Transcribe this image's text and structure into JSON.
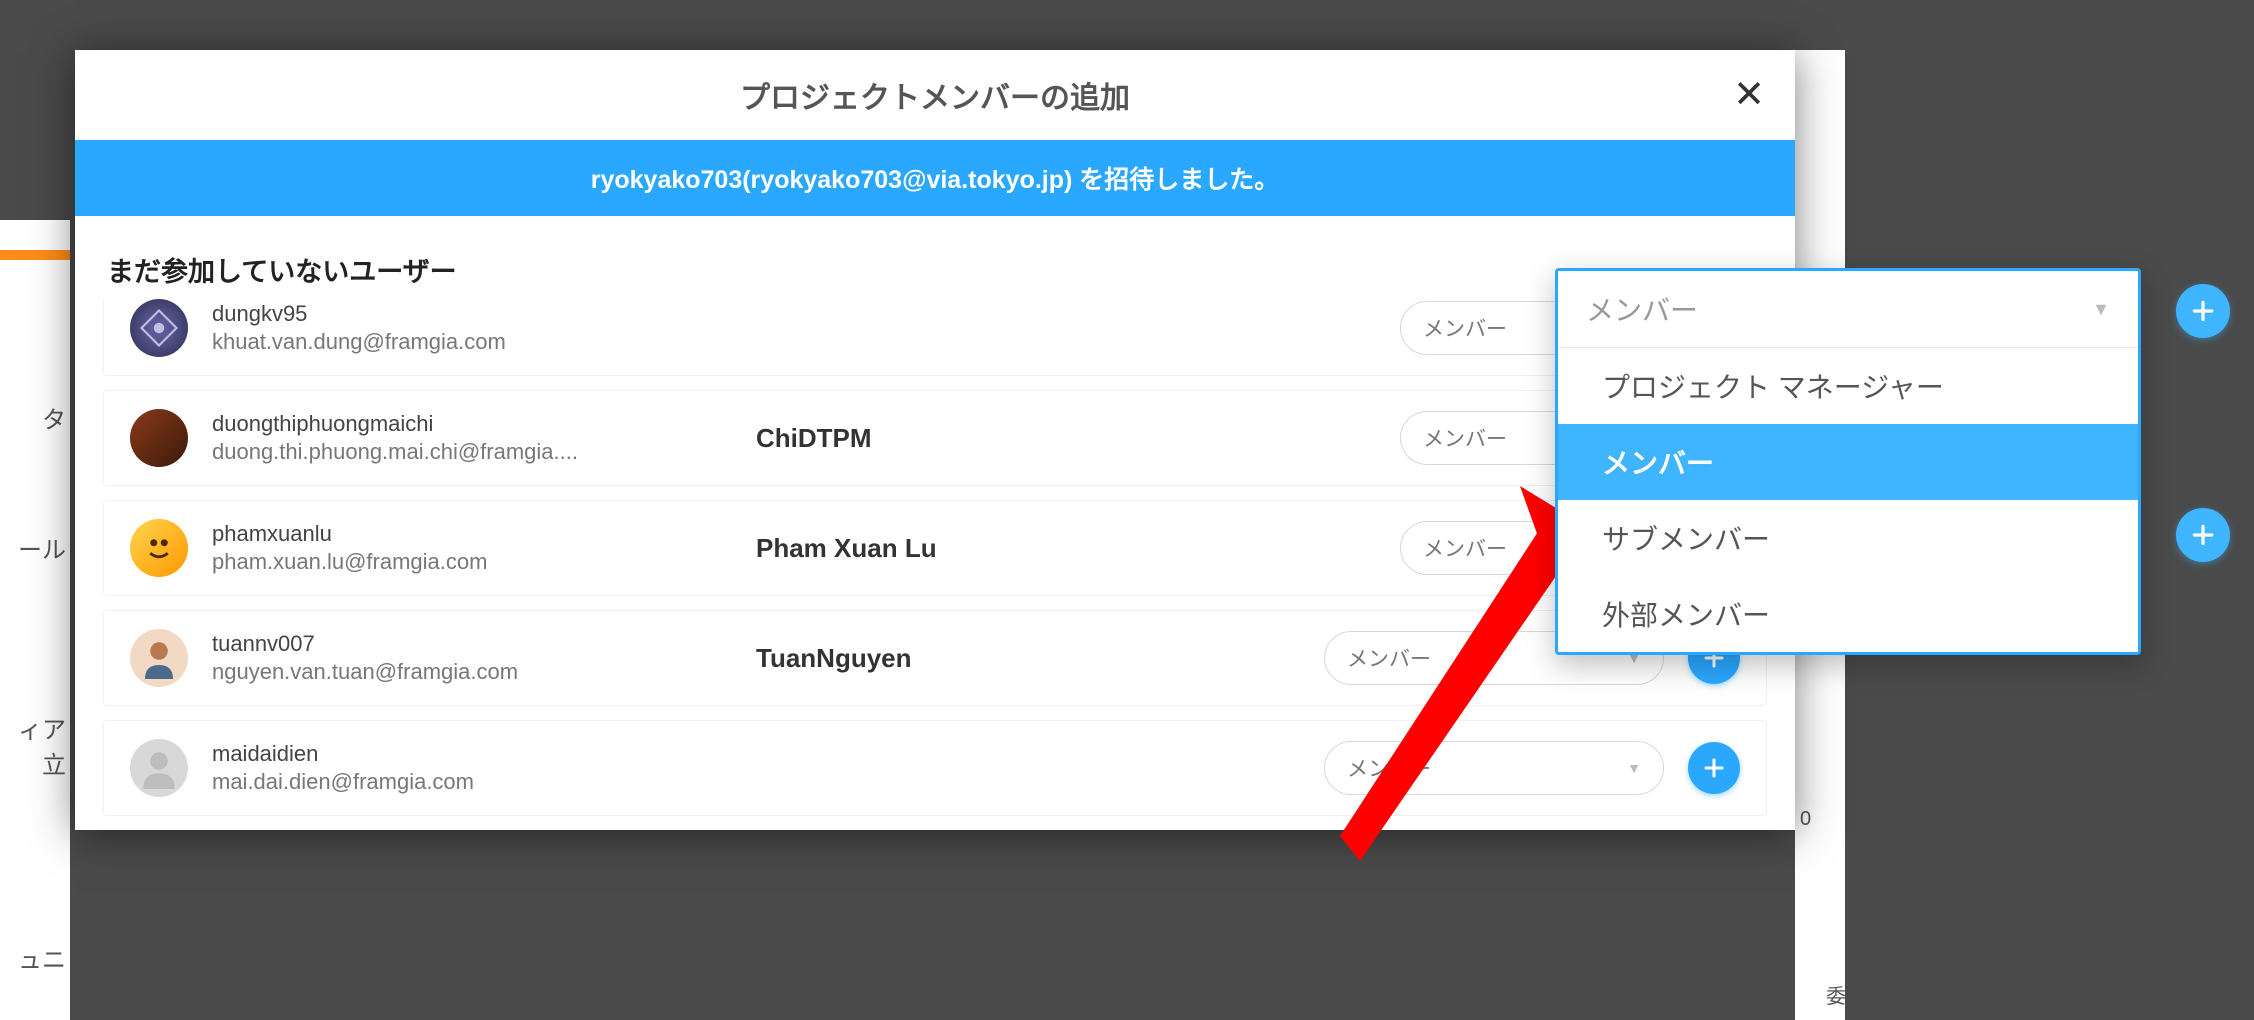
{
  "modal": {
    "title": "プロジェクトメンバーの追加",
    "banner": "ryokyako703(ryokyako703@via.tokyo.jp) を招待しました。",
    "section_title": "まだ参加していないユーザー"
  },
  "role_label": "メンバー",
  "users": [
    {
      "username": "dungkv95",
      "email": "khuat.van.dung@framgia.com",
      "display": ""
    },
    {
      "username": "duongthiphuongmaichi",
      "email": "duong.thi.phuong.mai.chi@framgia....",
      "display": "ChiDTPM"
    },
    {
      "username": "phamxuanlu",
      "email": "pham.xuan.lu@framgia.com",
      "display": "Pham Xuan Lu"
    },
    {
      "username": "tuannv007",
      "email": "nguyen.van.tuan@framgia.com",
      "display": "TuanNguyen"
    },
    {
      "username": "maidaidien",
      "email": "mai.dai.dien@framgia.com",
      "display": ""
    }
  ],
  "dropdown": {
    "selected": "メンバー",
    "options": [
      "プロジェクト マネージャー",
      "メンバー",
      "サブメンバー",
      "外部メンバー"
    ],
    "active_index": 1
  },
  "bg": {
    "side1": "タ",
    "side2": "ール",
    "side3": "ィア立",
    "side4": "ュニ",
    "right1": "0",
    "right2": "委"
  }
}
